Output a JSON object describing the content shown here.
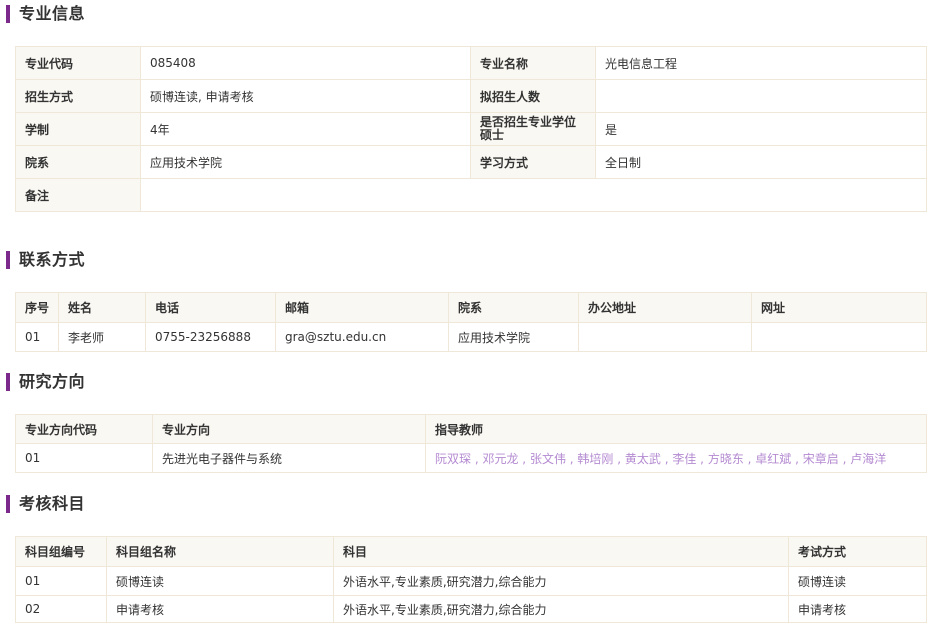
{
  "sections": {
    "info_title": "专业信息",
    "contact_title": "联系方式",
    "research_title": "研究方向",
    "exam_title": "考核科目"
  },
  "info": {
    "code_label": "专业代码",
    "code_value": "085408",
    "name_label": "专业名称",
    "name_value": "光电信息工程",
    "method_label": "招生方式",
    "method_value": "硕博连读, 申请考核",
    "quota_label": "拟招生人数",
    "quota_value": "",
    "duration_label": "学制",
    "duration_value": "4年",
    "professional_label": "是否招生专业学位硕士",
    "professional_value": "是",
    "dept_label": "院系",
    "dept_value": "应用技术学院",
    "study_label": "学习方式",
    "study_value": "全日制",
    "note_label": "备注",
    "note_value": ""
  },
  "contact": {
    "headers": [
      "序号",
      "姓名",
      "电话",
      "邮箱",
      "院系",
      "办公地址",
      "网址"
    ],
    "rows": [
      [
        "01",
        "李老师",
        "0755-23256888",
        "gra@sztu.edu.cn",
        "应用技术学院",
        "",
        ""
      ]
    ]
  },
  "research": {
    "headers": [
      "专业方向代码",
      "专业方向",
      "指导教师"
    ],
    "rows": [
      {
        "code": "01",
        "direction": "先进光电子器件与系统",
        "teachers": [
          "阮双琛",
          "邓元龙",
          "张文伟",
          "韩培刚",
          "黄太武",
          "李佳",
          "方晓东",
          "卓红斌",
          "宋章启",
          "卢海洋"
        ]
      }
    ],
    "separator": " , "
  },
  "exam": {
    "headers": [
      "科目组编号",
      "科目组名称",
      "科目",
      "考试方式"
    ],
    "rows": [
      [
        "01",
        "硕博连读",
        "外语水平,专业素质,研究潜力,综合能力",
        "硕博连读"
      ],
      [
        "02",
        "申请考核",
        "外语水平,专业素质,研究潜力,综合能力",
        "申请考核"
      ]
    ]
  },
  "colors": {
    "accent": "#7b2a8c",
    "link": "#b48ad1",
    "border": "#efe8d9",
    "header_bg": "#faf8f3"
  }
}
